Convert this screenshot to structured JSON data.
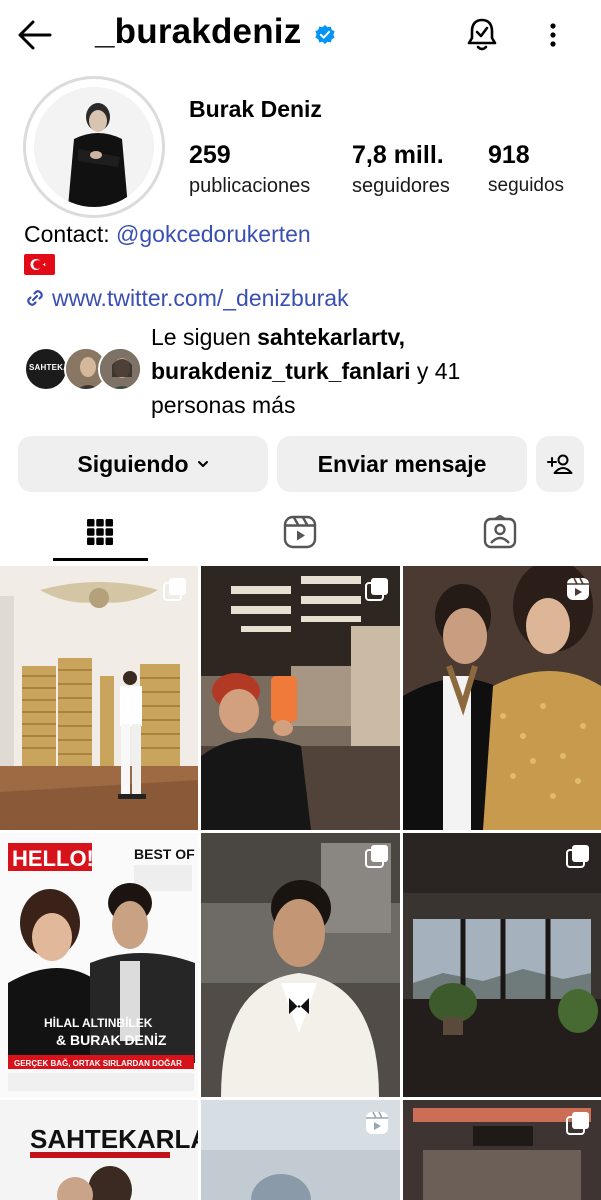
{
  "header": {
    "username": "_burakdeniz",
    "verified": true
  },
  "profile": {
    "display_name": "Burak Deniz",
    "stats": [
      {
        "value": "259",
        "label": "publicaciones"
      },
      {
        "value": "7,8 mill.",
        "label": "seguidores"
      },
      {
        "value": "918",
        "label": "seguidos"
      }
    ],
    "bio": {
      "contact_prefix": "Contact: ",
      "contact_handle": "@gokcedorukerten",
      "flag": "turkey-flag",
      "link": "www.twitter.com/_denizburak"
    },
    "followed_by": {
      "prefix": "Le siguen ",
      "user1": "sahtekarlartv,",
      "user2": "burakdeniz_turk_fanlari",
      "suffix": " y 41 personas más",
      "avatar1_text": "SAHTEKARLAR"
    }
  },
  "actions": {
    "following_label": "Siguiendo",
    "message_label": "Enviar mensaje"
  },
  "tabs": [
    {
      "name": "posts-grid",
      "icon": "grid-icon",
      "active": true
    },
    {
      "name": "reels",
      "icon": "reels-icon",
      "active": false
    },
    {
      "name": "tagged",
      "icon": "tagged-icon",
      "active": false
    }
  ],
  "grid": {
    "posts": [
      {
        "type": "carousel",
        "subject": "man in white suit with stacked gold chairs"
      },
      {
        "type": "carousel",
        "subject": "mirror selfie in trailer"
      },
      {
        "type": "reel",
        "subject": "couple in gold sequin dress"
      },
      {
        "type": "photo",
        "subject": "HELLO! magazine cover",
        "cover_brand": "HELLO!",
        "cover_text_1": "BEST OF",
        "cover_text_2": "HİLAL ALTINBİLEK",
        "cover_text_3": "& BURAK DENİZ",
        "cover_text_4": "GERÇEK BAĞ, ORTAK SIRLARDAN DOĞAR"
      },
      {
        "type": "carousel",
        "subject": "man in white tuxedo"
      },
      {
        "type": "carousel",
        "subject": "room with window and plants"
      },
      {
        "type": "photo",
        "subject": "SAHTEKARLAR poster",
        "poster_text": "SAHTEKARLAR"
      },
      {
        "type": "reel",
        "subject": "outdoor photo"
      },
      {
        "type": "carousel",
        "subject": "trailer interior"
      }
    ]
  },
  "colors": {
    "link": "#3a4fb3",
    "verified": "#0095f6",
    "button_bg": "#efefef",
    "flag_red": "#e30a17"
  }
}
